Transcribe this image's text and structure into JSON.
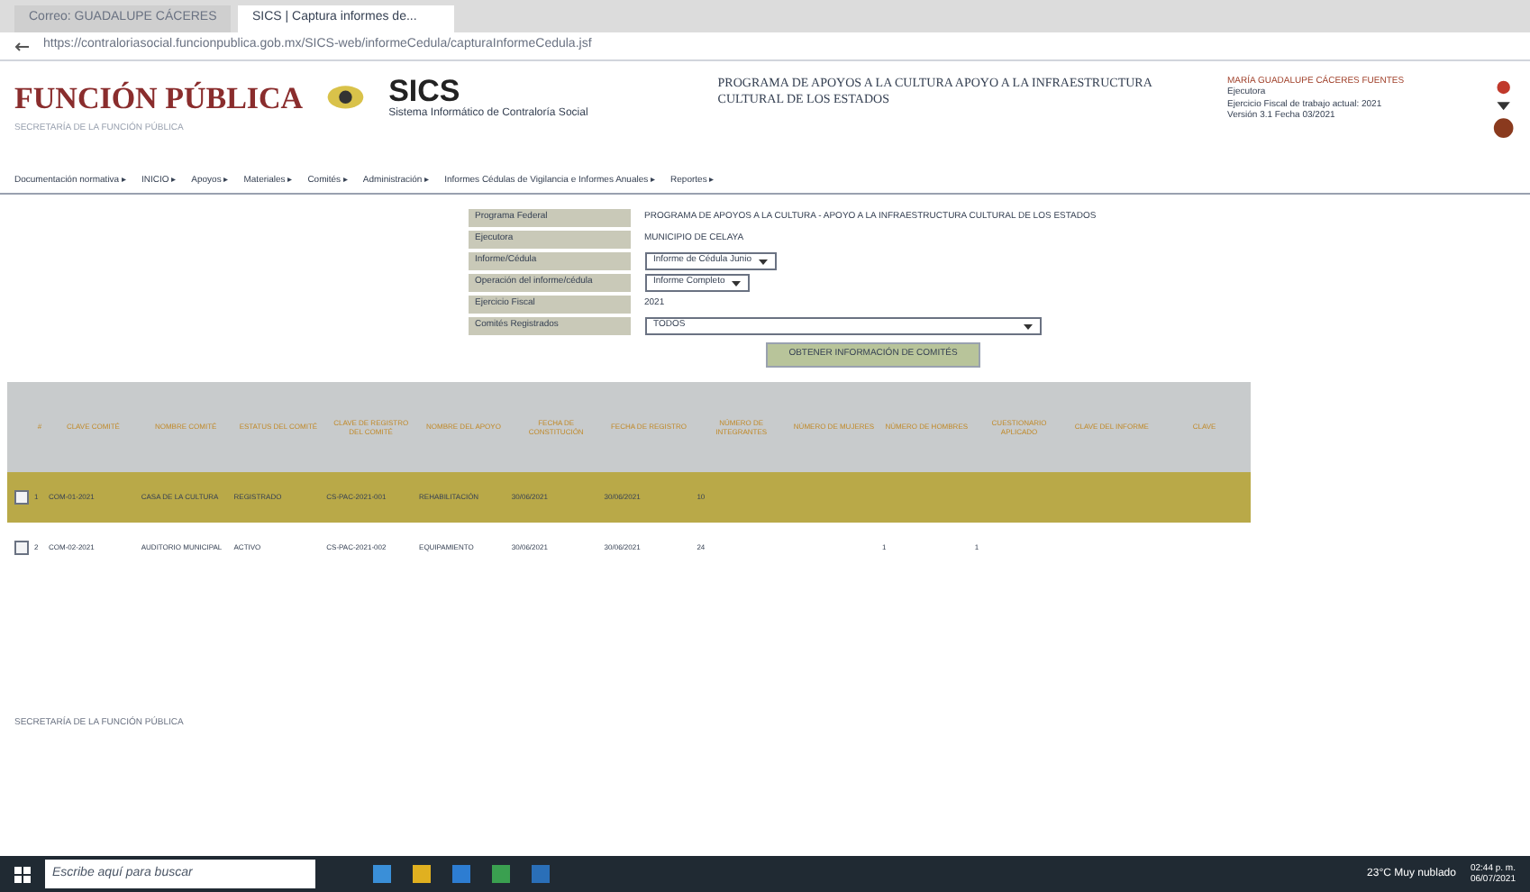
{
  "browser": {
    "tabs": [
      {
        "label": "Correo: GUADALUPE CÁCERES",
        "selected": false
      },
      {
        "label": "SICS | Captura informes de...",
        "selected": true
      }
    ],
    "url": "https://contraloriasocial.funcionpublica.gob.mx/SICS-web/informeCedula/capturaInformeCedula.jsf"
  },
  "header": {
    "brand": "FUNCIÓN PÚBLICA",
    "brand_sub": "SECRETARÍA DE LA FUNCIÓN PÚBLICA",
    "app": "SICS",
    "app_sub": "Sistema Informático de Contraloría Social",
    "program": "PROGRAMA DE APOYOS A LA CULTURA  APOYO A LA INFRAESTRUCTURA CULTURAL DE LOS ESTADOS",
    "user": "MARÍA GUADALUPE CÁCERES FUENTES",
    "role": "Ejecutora",
    "fiscal": "Ejercicio Fiscal de trabajo actual: 2021",
    "version": "Versión 3.1  Fecha 03/2021"
  },
  "menu": [
    "Documentación normativa ▸",
    "INICIO ▸",
    "Apoyos ▸",
    "Materiales ▸",
    "Comités ▸",
    "Administración ▸",
    "Informes Cédulas de Vigilancia e Informes Anuales ▸",
    "Reportes ▸"
  ],
  "form": [
    {
      "kind": "text",
      "label": "Programa Federal",
      "value": "PROGRAMA DE APOYOS A LA CULTURA - APOYO A LA INFRAESTRUCTURA CULTURAL DE LOS ESTADOS"
    },
    {
      "kind": "text",
      "label": "Ejecutora",
      "value": "MUNICIPIO DE CELAYA"
    },
    {
      "kind": "select",
      "label": "Informe/Cédula",
      "value": "Informe de Cédula Junio"
    },
    {
      "kind": "select",
      "label": "Operación del informe/cédula",
      "value": "Informe Completo"
    },
    {
      "kind": "text",
      "label": "Ejercicio Fiscal",
      "value": "2021"
    },
    {
      "kind": "wide-select",
      "label": "Comités Registrados",
      "value": "TODOS"
    }
  ],
  "action_button": "OBTENER INFORMACIÓN DE COMITÉS",
  "table": {
    "columns": [
      "#",
      "CLAVE COMITÉ",
      "NOMBRE COMITÉ",
      "ESTATUS DEL COMITÉ",
      "CLAVE DE REGISTRO DEL COMITÉ",
      "NOMBRE DEL APOYO",
      "FECHA DE CONSTITUCIÓN",
      "FECHA DE REGISTRO",
      "NÚMERO DE INTEGRANTES",
      "NÚMERO DE MUJERES",
      "NÚMERO DE HOMBRES",
      "CUESTIONARIO APLICADO",
      "CLAVE DEL INFORME",
      "CLAVE"
    ],
    "rows": [
      {
        "selected": true,
        "cells": [
          "1",
          "COM-01-2021",
          "CASA DE LA CULTURA",
          "REGISTRADO",
          "CS-PAC-2021-001",
          "REHABILITACIÓN",
          "30/06/2021",
          "30/06/2021",
          "10",
          "",
          "",
          "",
          "",
          ""
        ]
      },
      {
        "selected": false,
        "cells": [
          "2",
          "COM-02-2021",
          "AUDITORIO MUNICIPAL",
          "ACTIVO",
          "CS-PAC-2021-002",
          "EQUIPAMIENTO",
          "30/06/2021",
          "30/06/2021",
          "24",
          "",
          "1",
          "1",
          "",
          ""
        ]
      }
    ]
  },
  "footer": "SECRETARÍA DE LA FUNCIÓN PÚBLICA",
  "taskbar": {
    "search": "Escribe aquí para buscar",
    "weather": "23°C  Muy nublado",
    "time": "02:44 p. m.",
    "date": "06/07/2021"
  }
}
